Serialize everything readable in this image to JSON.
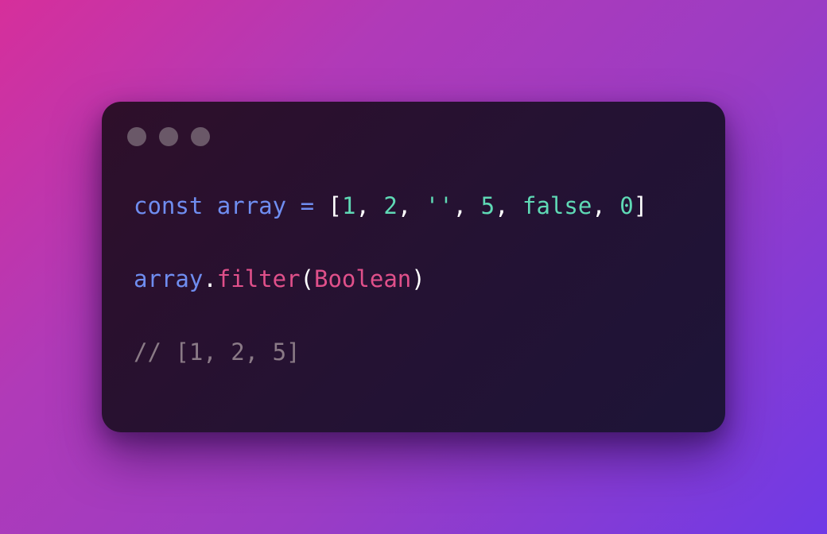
{
  "window": {
    "controls": [
      "dot-1",
      "dot-2",
      "dot-3"
    ]
  },
  "code": {
    "line1": {
      "keyword": "const",
      "space1": " ",
      "identifier": "array",
      "space2": " ",
      "operator": "=",
      "space3": " ",
      "open_bracket": "[",
      "v1": "1",
      "c1": ", ",
      "v2": "2",
      "c2": ", ",
      "v3": "''",
      "c3": ", ",
      "v4": "5",
      "c4": ", ",
      "v5": "false",
      "c5": ", ",
      "v6": "0",
      "close_bracket": "]"
    },
    "line2": {
      "object": "array",
      "dot": ".",
      "method": "filter",
      "open_paren": "(",
      "argument": "Boolean",
      "close_paren": ")"
    },
    "line3": {
      "comment": "// [1, 2, 5]"
    }
  },
  "colors": {
    "keyword": "#6f8df0",
    "literal": "#5fd9b5",
    "function": "#e0508a",
    "comment": "#8a7a86",
    "punctuation": "#ffffff",
    "window_dot": "#6a5868"
  }
}
